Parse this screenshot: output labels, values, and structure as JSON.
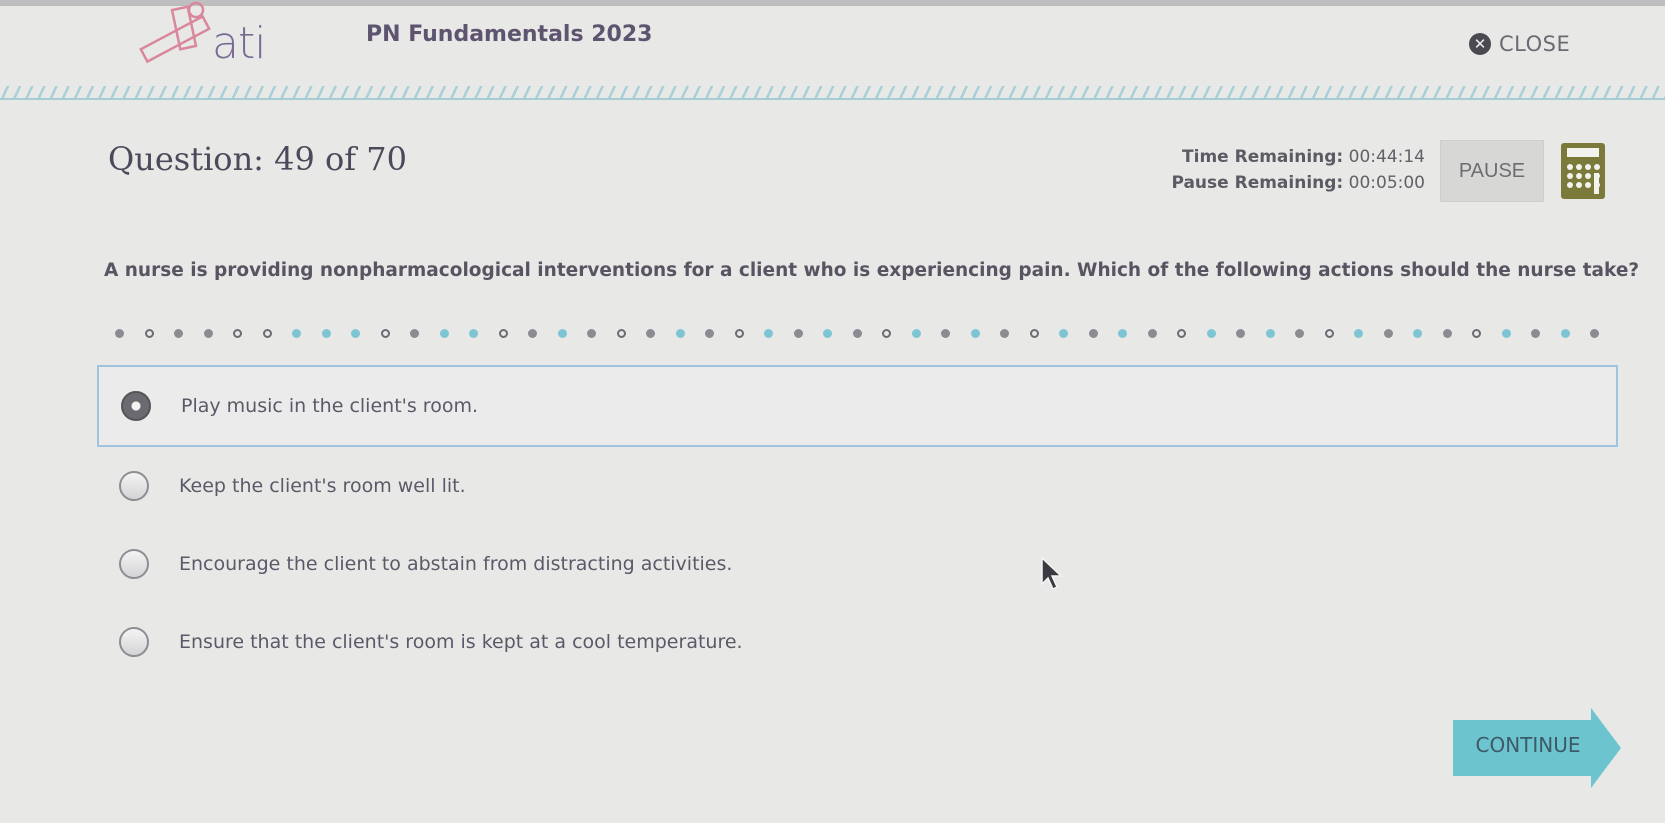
{
  "header": {
    "logo_text": "ati",
    "app_title": "PN Fundamentals 2023",
    "close_label": "CLOSE"
  },
  "question": {
    "title": "Question: 49 of 70",
    "current": 49,
    "total": 70,
    "text": "A nurse is providing nonpharmacological interventions for a client who is experiencing pain. Which of the following actions should the nurse take?"
  },
  "timers": {
    "time_label": "Time Remaining:",
    "time_value": "00:44:14",
    "pause_label": "Pause Remaining:",
    "pause_value": "00:05:00"
  },
  "toolbar": {
    "pause_label": "PAUSE",
    "calculator_icon": "calculator-icon"
  },
  "progress_dots": [
    "gray",
    "ring",
    "gray",
    "gray",
    "ring",
    "ring",
    "blue",
    "blue",
    "blue",
    "ring",
    "gray",
    "blue",
    "blue",
    "ring",
    "gray",
    "blue",
    "gray",
    "ring",
    "gray",
    "blue",
    "gray",
    "ring",
    "blue",
    "gray",
    "blue",
    "gray",
    "ring",
    "blue",
    "gray",
    "blue",
    "gray",
    "ring",
    "blue",
    "gray",
    "blue",
    "gray",
    "ring",
    "blue",
    "gray",
    "blue",
    "gray",
    "ring",
    "blue",
    "gray",
    "blue",
    "gray",
    "ring",
    "blue",
    "gray",
    "blue",
    "gray"
  ],
  "options": [
    {
      "label": "Play music in the client's room.",
      "selected": true
    },
    {
      "label": "Keep the client's room well lit.",
      "selected": false
    },
    {
      "label": "Encourage the client to abstain from distracting activities.",
      "selected": false
    },
    {
      "label": "Ensure that the client's room is kept at a cool temperature.",
      "selected": false
    }
  ],
  "footer": {
    "continue_label": "CONTINUE"
  },
  "colors": {
    "accent": "#6cc4cf",
    "progress_blue": "#7ec5d4",
    "progress_gray": "#8d8a92",
    "selected_border": "#9ec4df",
    "calculator": "#7c7a3a"
  }
}
